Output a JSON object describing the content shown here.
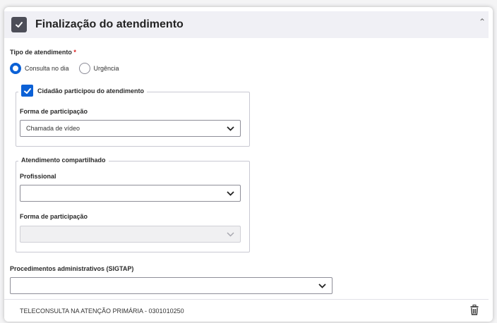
{
  "section": {
    "title": "Finalização do atendimento",
    "collapse_glyph": "⌃"
  },
  "tipo": {
    "label": "Tipo de atendimento",
    "required_mark": "*",
    "options": [
      {
        "label": "Consulta no dia",
        "selected": true
      },
      {
        "label": "Urgência",
        "selected": false
      }
    ]
  },
  "participacao": {
    "checkbox_label": "Cidadão participou do atendimento",
    "checked": true,
    "forma_label": "Forma de participação",
    "forma_value": "Chamada de vídeo"
  },
  "compartilhado": {
    "legend": "Atendimento compartilhado",
    "profissional_label": "Profissional",
    "profissional_value": "",
    "forma_label": "Forma de participação",
    "forma_value": ""
  },
  "procedimentos": {
    "label": "Procedimentos administrativos (SIGTAP)",
    "value": "",
    "items": [
      {
        "text": "TELECONSULTA NA ATENÇÃO PRIMÁRIA - 0301010250"
      }
    ]
  },
  "icons": {
    "header": "check-square-icon",
    "chevron": "chevron-down-icon",
    "trash": "trash-icon"
  },
  "colors": {
    "accent": "#0c61d6",
    "header_bg": "#f0f0f5",
    "required": "#d81919"
  }
}
